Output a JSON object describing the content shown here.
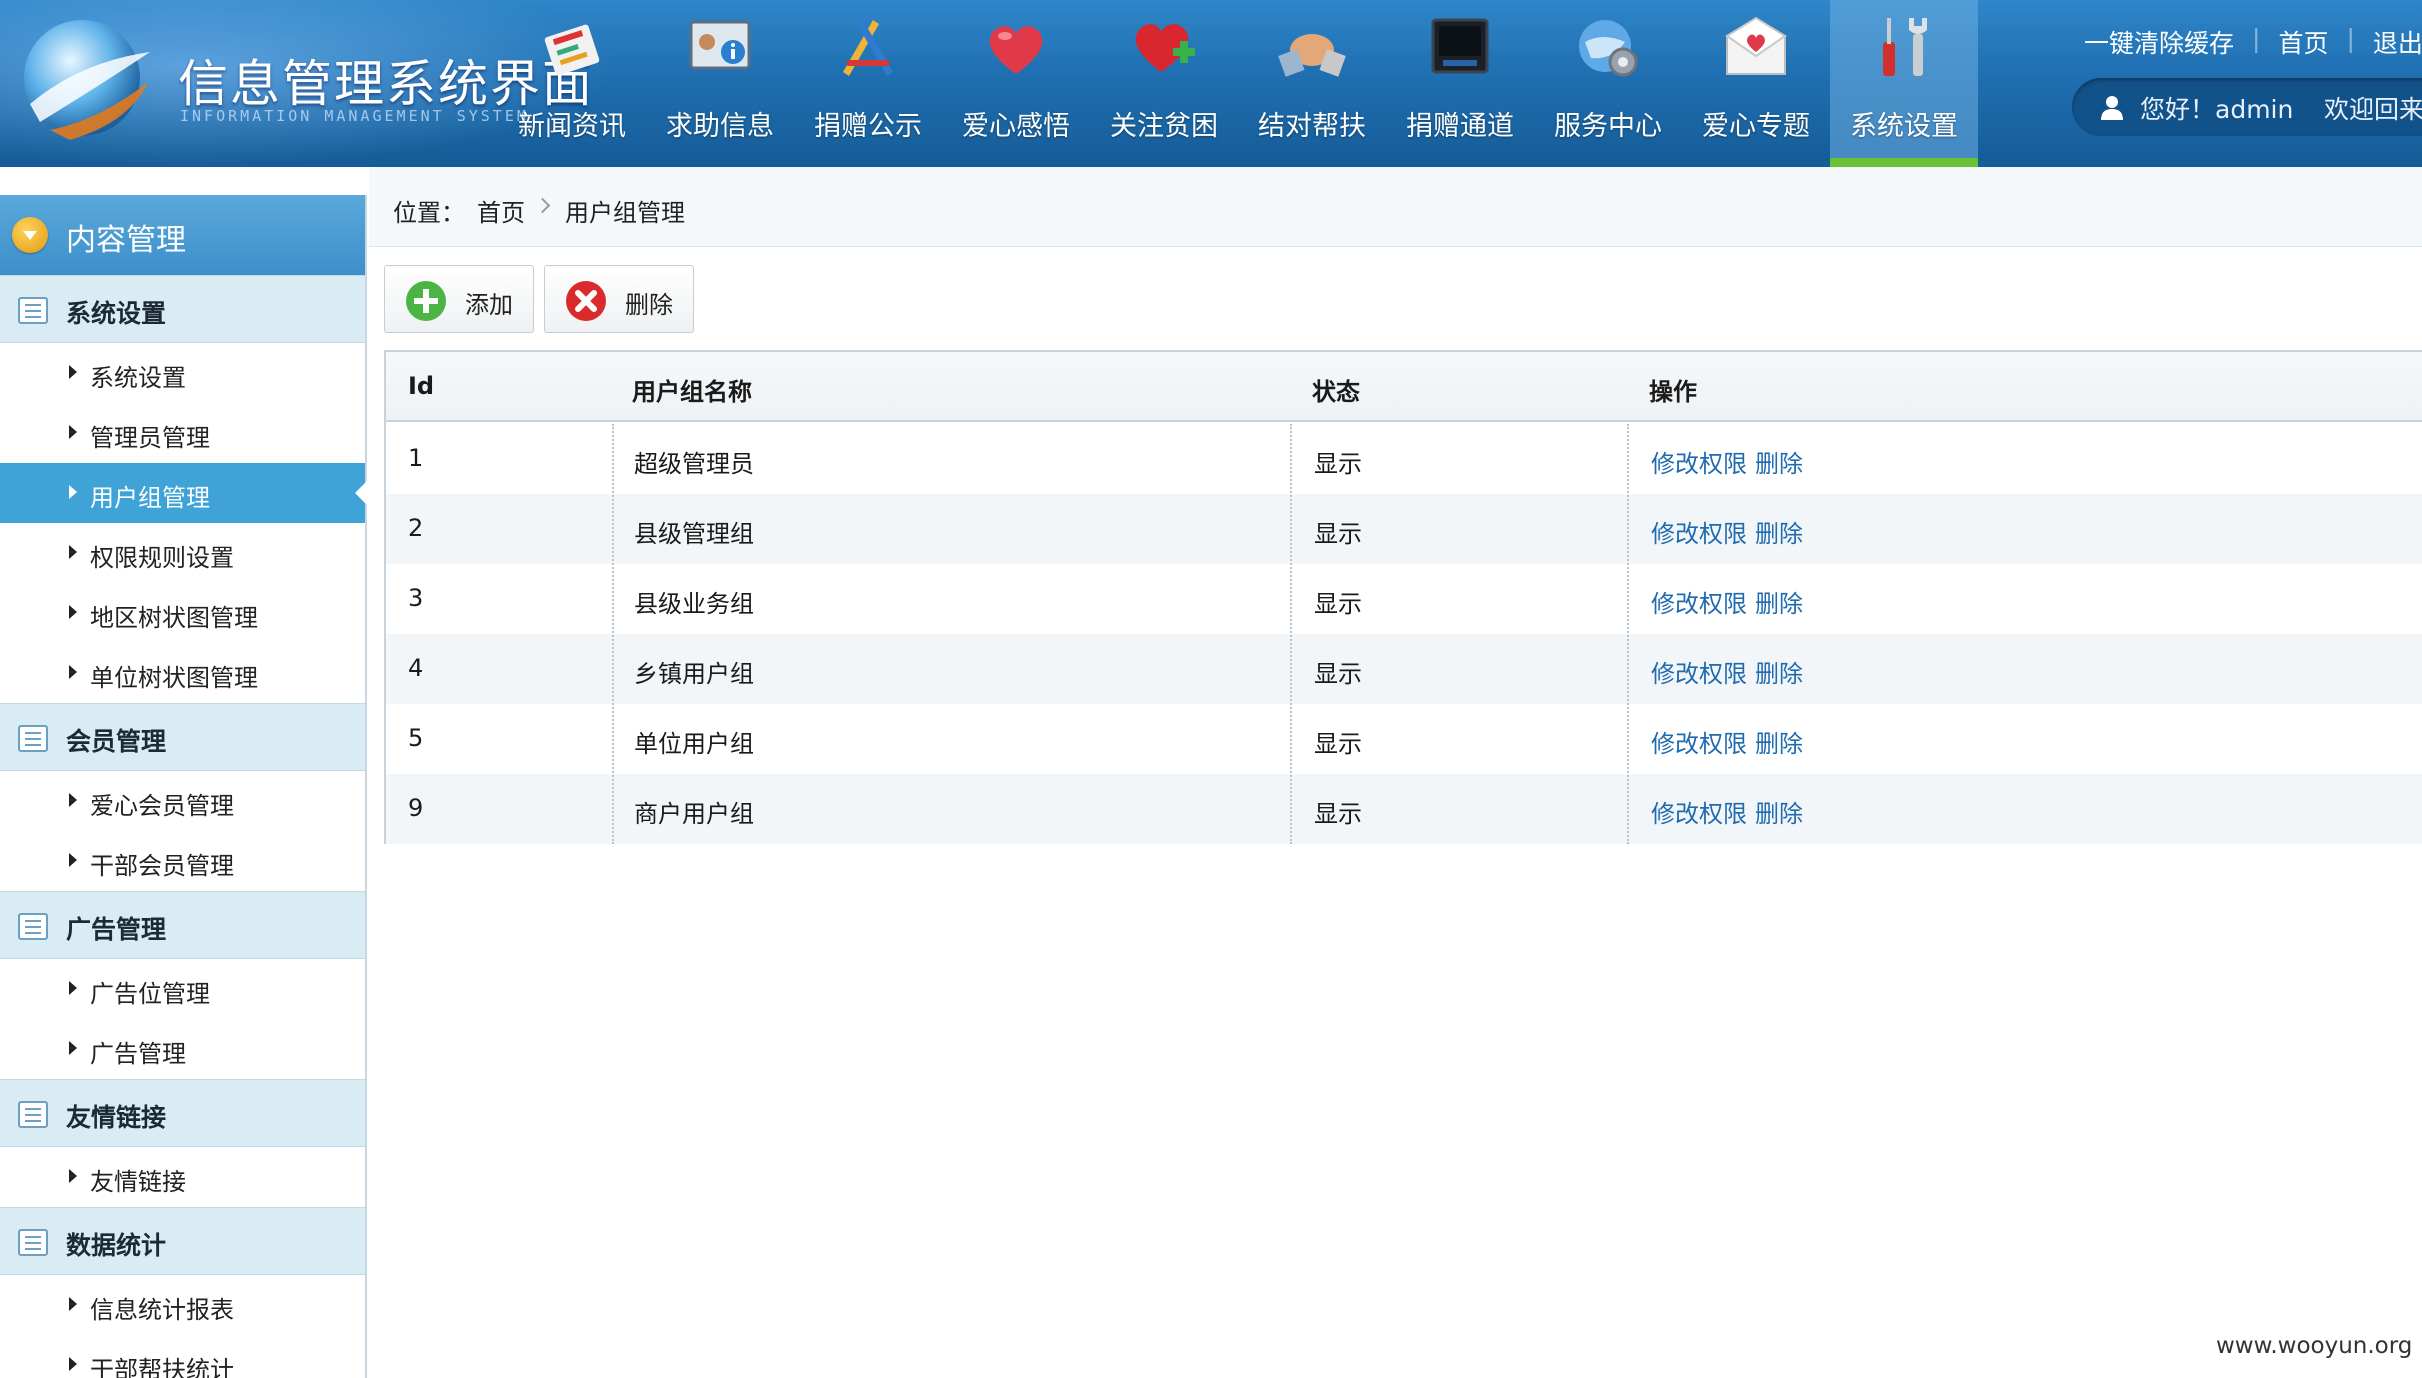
{
  "header": {
    "logo_title": "信息管理系统界面",
    "logo_subtitle": "INFORMATION MANAGEMENT SYSTEM",
    "nav": [
      {
        "label": "新闻资讯",
        "icon": "newspaper-icon"
      },
      {
        "label": "求助信息",
        "icon": "info-board-icon"
      },
      {
        "label": "捐赠公示",
        "icon": "pencil-ruler-icon"
      },
      {
        "label": "爱心感悟",
        "icon": "heart-icon"
      },
      {
        "label": "关注贫困",
        "icon": "heart-plus-icon"
      },
      {
        "label": "结对帮扶",
        "icon": "handshake-icon"
      },
      {
        "label": "捐赠通道",
        "icon": "monitor-icon"
      },
      {
        "label": "服务中心",
        "icon": "globe-gear-icon"
      },
      {
        "label": "爱心专题",
        "icon": "heart-envelope-icon"
      },
      {
        "label": "系统设置",
        "icon": "tools-icon",
        "active": true
      }
    ],
    "toplinks": {
      "clear_cache": "一键清除缓存",
      "home": "首页",
      "logout": "退出"
    },
    "welcome": {
      "greeting": "您好！admin",
      "welcome": "欢迎回来"
    }
  },
  "sidebar": {
    "title": "内容管理",
    "groups": [
      {
        "label": "系统设置",
        "items": [
          "系统设置",
          "管理员管理",
          "用户组管理",
          "权限规则设置",
          "地区树状图管理",
          "单位树状图管理"
        ]
      },
      {
        "label": "会员管理",
        "items": [
          "爱心会员管理",
          "干部会员管理"
        ]
      },
      {
        "label": "广告管理",
        "items": [
          "广告位管理",
          "广告管理"
        ]
      },
      {
        "label": "友情链接",
        "items": [
          "友情链接"
        ]
      },
      {
        "label": "数据统计",
        "items": [
          "信息统计报表",
          "干部帮扶统计"
        ]
      }
    ],
    "active_item": "用户组管理"
  },
  "breadcrumb": {
    "prefix": "位置：",
    "home": "首页",
    "current": "用户组管理"
  },
  "toolbar": {
    "add_label": "添加",
    "delete_label": "删除"
  },
  "table": {
    "headers": [
      "Id",
      "用户组名称",
      "状态",
      "操作"
    ],
    "rows": [
      {
        "id": "1",
        "name": "超级管理员",
        "status": "显示",
        "edit": "修改权限",
        "del": "删除"
      },
      {
        "id": "2",
        "name": "县级管理组",
        "status": "显示",
        "edit": "修改权限",
        "del": "删除"
      },
      {
        "id": "3",
        "name": "县级业务组",
        "status": "显示",
        "edit": "修改权限",
        "del": "删除"
      },
      {
        "id": "4",
        "name": "乡镇用户组",
        "status": "显示",
        "edit": "修改权限",
        "del": "删除"
      },
      {
        "id": "5",
        "name": "单位用户组",
        "status": "显示",
        "edit": "修改权限",
        "del": "删除"
      },
      {
        "id": "9",
        "name": "商户用户组",
        "status": "显示",
        "edit": "修改权限",
        "del": "删除"
      }
    ]
  },
  "watermark": "www.wooyun.org",
  "colors": {
    "header_blue": "#1f6fb1",
    "active_sidebar": "#3fa3d8",
    "link_blue": "#1f6bb0",
    "active_tab_underline": "#6ac135"
  }
}
